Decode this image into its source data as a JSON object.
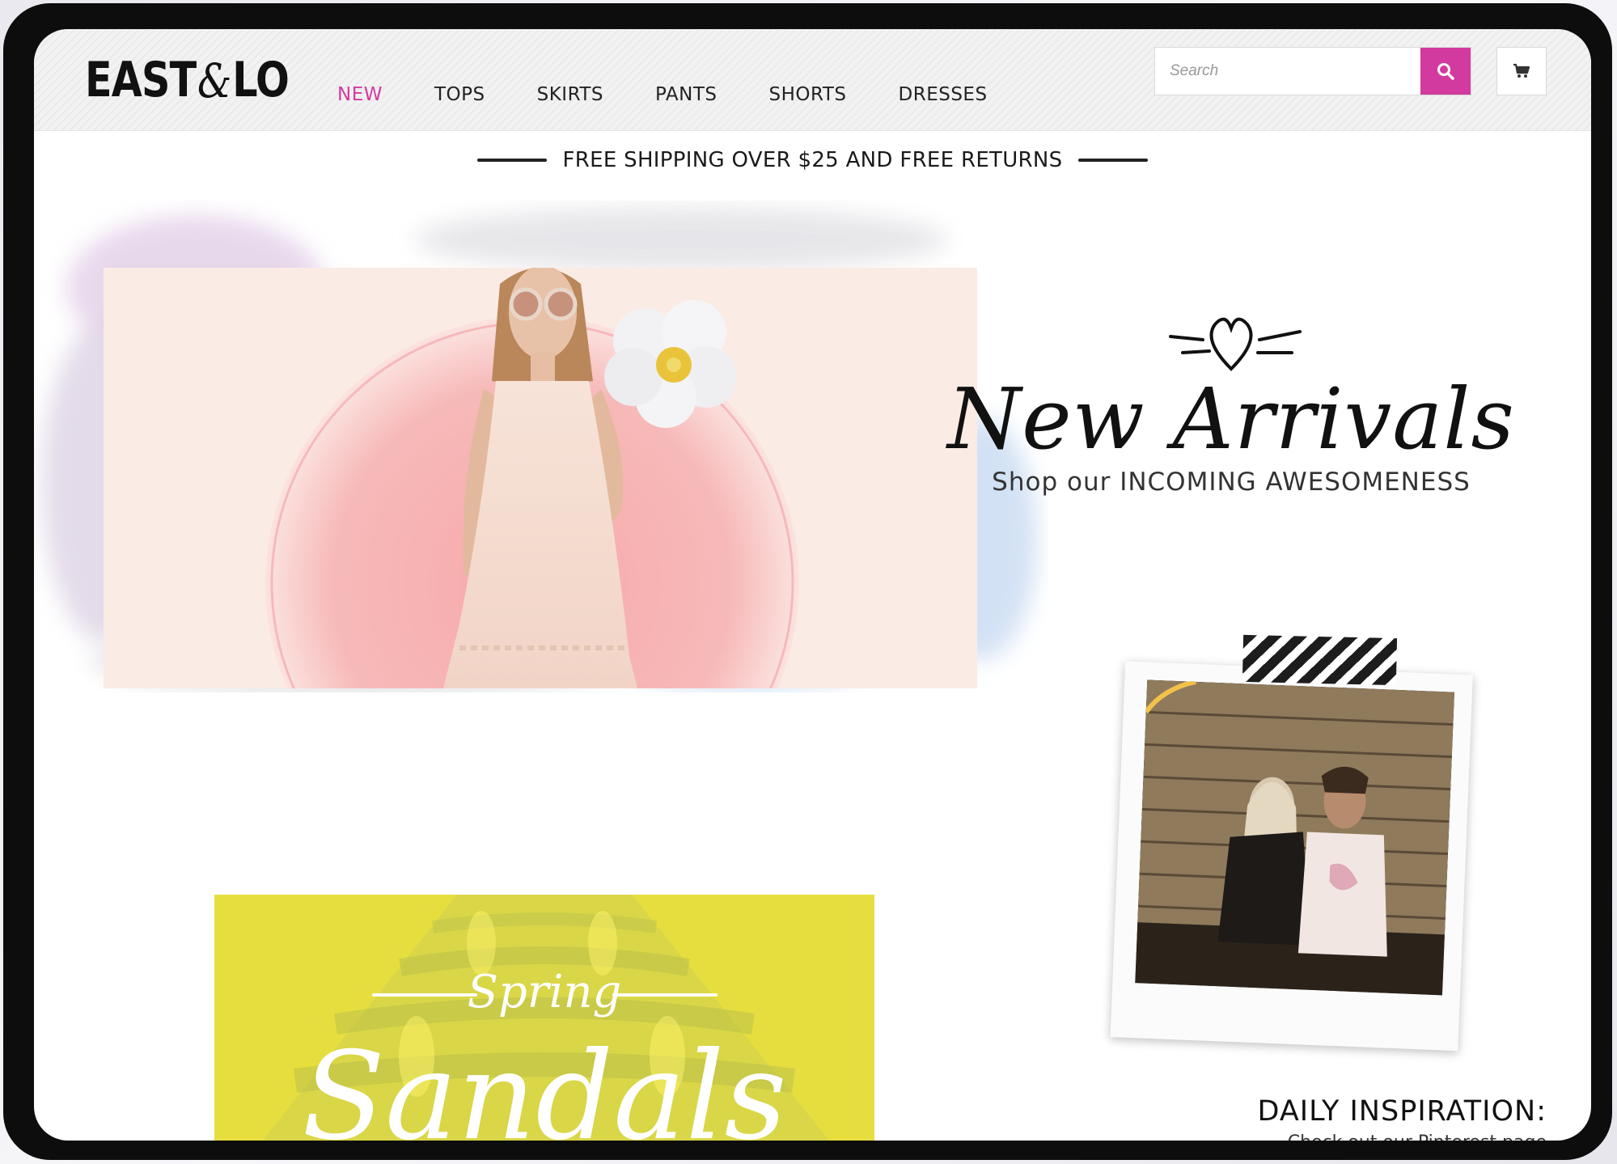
{
  "brand": {
    "logo_left": "EAST",
    "logo_amp": "&",
    "logo_right": "LO"
  },
  "nav": {
    "items": [
      {
        "label": "NEW",
        "active": true
      },
      {
        "label": "TOPS"
      },
      {
        "label": "SKIRTS"
      },
      {
        "label": "PANTS"
      },
      {
        "label": "SHORTS"
      },
      {
        "label": "DRESSES"
      }
    ]
  },
  "search": {
    "placeholder": "Search",
    "icon": "search-icon"
  },
  "cart": {
    "icon": "cart-icon"
  },
  "shipping": {
    "text": "FREE SHIPPING OVER $25 AND FREE RETURNS"
  },
  "hero": {
    "title": "New Arrivals",
    "subtitle": "Shop our INCOMING AWESOMENESS"
  },
  "promo": {
    "spring": "Spring",
    "sandals": "Sandals"
  },
  "inspiration": {
    "title": "DAILY INSPIRATION:",
    "subtitle": "Check out our Pinterest page"
  },
  "colors": {
    "accent": "#d33a9f",
    "text": "#111111",
    "banner_yellow": "#e4dc3e"
  }
}
